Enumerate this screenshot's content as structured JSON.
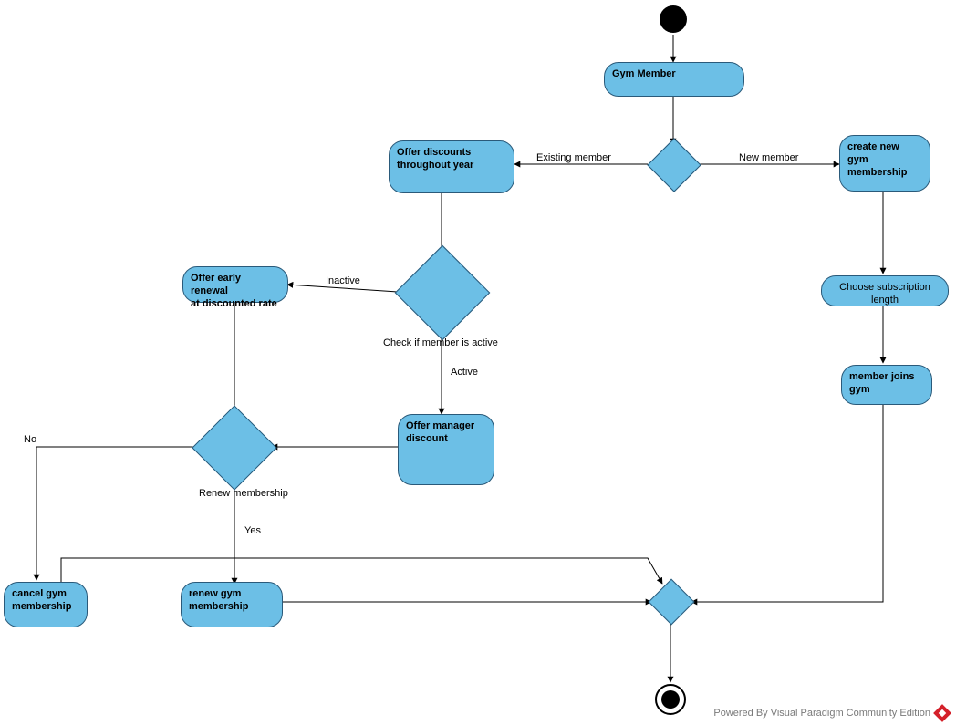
{
  "nodes": {
    "gym_member": "Gym Member",
    "offer_discounts": [
      "Offer discounts",
      "throughout year"
    ],
    "create_new": [
      "create new",
      "gym",
      "membership"
    ],
    "early_renewal": [
      "Offer early renewal",
      "at discounted rate"
    ],
    "choose_sub": "Choose subscription length",
    "member_joins": [
      "member joins",
      "gym"
    ],
    "manager_discount": [
      "Offer manager",
      "discount"
    ],
    "cancel": [
      "cancel gym",
      "membership"
    ],
    "renew": [
      "renew gym",
      "membership"
    ]
  },
  "edge_labels": {
    "existing_member": "Existing member",
    "new_member": "New member",
    "inactive": "Inactive",
    "active": "Active",
    "check_active": "Check if member is active",
    "renew_membership": "Renew membership",
    "no": "No",
    "yes": "Yes"
  },
  "footer": "Powered By   Visual Paradigm Community Edition",
  "colors": {
    "node_fill": "#6cbfe6",
    "node_border": "#2a5a7a"
  }
}
